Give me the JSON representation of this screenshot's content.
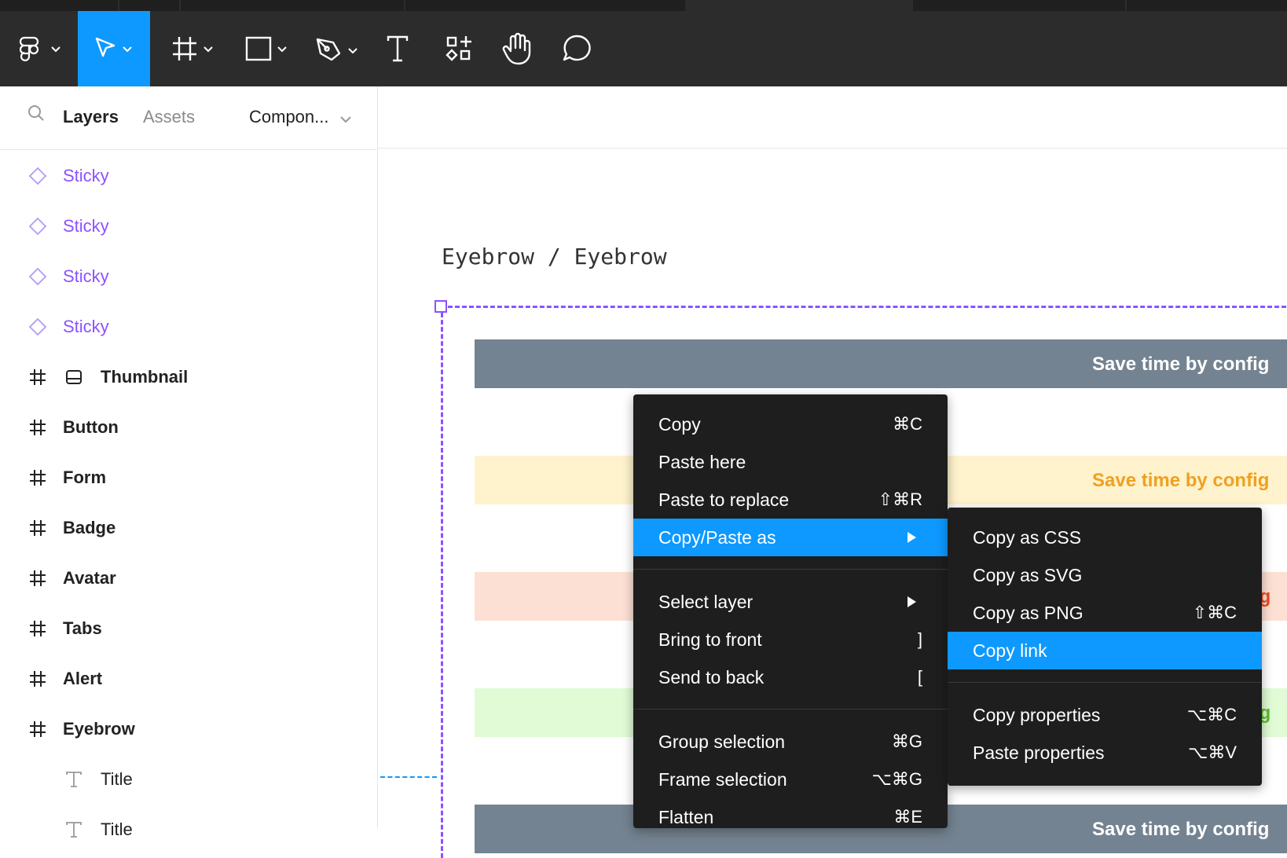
{
  "toolbar": {
    "icons": [
      "figma-menu-icon",
      "move-tool-icon",
      "frame-tool-icon",
      "shape-tool-icon",
      "pen-tool-icon",
      "text-tool-icon",
      "resources-icon",
      "hand-tool-icon",
      "comment-tool-icon"
    ]
  },
  "sidebar": {
    "tabs": {
      "layers": "Layers",
      "assets": "Assets",
      "page": "Compon..."
    },
    "layers": [
      {
        "label": "Sticky",
        "icon": "component-instance-icon",
        "kind": "component"
      },
      {
        "label": "Sticky",
        "icon": "component-instance-icon",
        "kind": "component"
      },
      {
        "label": "Sticky",
        "icon": "component-instance-icon",
        "kind": "component"
      },
      {
        "label": "Sticky",
        "icon": "component-instance-icon",
        "kind": "component"
      },
      {
        "label": "Thumbnail",
        "icon": "frame-icon",
        "kind": "frame"
      },
      {
        "label": "Button",
        "icon": "frame-icon",
        "kind": "frame"
      },
      {
        "label": "Form",
        "icon": "frame-icon",
        "kind": "frame"
      },
      {
        "label": "Badge",
        "icon": "frame-icon",
        "kind": "frame"
      },
      {
        "label": "Avatar",
        "icon": "frame-icon",
        "kind": "frame"
      },
      {
        "label": "Tabs",
        "icon": "frame-icon",
        "kind": "frame"
      },
      {
        "label": "Alert",
        "icon": "frame-icon",
        "kind": "frame"
      },
      {
        "label": "Eyebrow",
        "icon": "frame-icon",
        "kind": "frame"
      },
      {
        "label": "Title",
        "icon": "text-layer-icon",
        "kind": "text"
      },
      {
        "label": "Title",
        "icon": "text-layer-icon",
        "kind": "text"
      }
    ]
  },
  "canvas": {
    "frame_title": "Eyebrow / Eyebrow",
    "banners": [
      {
        "text": "Save time by config",
        "bg": "#748391",
        "color": "#ffffff"
      },
      {
        "text": "Save time by config",
        "bg": "#fff3cd",
        "color": "#f0a020"
      },
      {
        "text": "fig",
        "bg": "#fde0d4",
        "color": "#f24822"
      },
      {
        "text": "fig",
        "bg": "#e1fbd6",
        "color": "#5bbd2e"
      },
      {
        "text": "Save time by config",
        "bg": "#748391",
        "color": "#ffffff"
      }
    ]
  },
  "context_menu": {
    "items": [
      {
        "label": "Copy",
        "shortcut": "⌘C"
      },
      {
        "label": "Paste here",
        "shortcut": ""
      },
      {
        "label": "Paste to replace",
        "shortcut": "⇧⌘R"
      },
      {
        "label": "Copy/Paste as",
        "shortcut": "",
        "submenu": true,
        "highlighted": true
      },
      {
        "label": "Select layer",
        "shortcut": "",
        "submenu": true
      },
      {
        "label": "Bring to front",
        "shortcut": "]"
      },
      {
        "label": "Send to back",
        "shortcut": "["
      },
      {
        "label": "Group selection",
        "shortcut": "⌘G"
      },
      {
        "label": "Frame selection",
        "shortcut": "⌥⌘G"
      },
      {
        "label": "Flatten",
        "shortcut": "⌘E"
      }
    ]
  },
  "submenu": {
    "items": [
      {
        "label": "Copy as CSS",
        "shortcut": ""
      },
      {
        "label": "Copy as SVG",
        "shortcut": ""
      },
      {
        "label": "Copy as PNG",
        "shortcut": "⇧⌘C"
      },
      {
        "label": "Copy link",
        "shortcut": "",
        "highlighted": true
      },
      {
        "label": "Copy properties",
        "shortcut": "⌥⌘C"
      },
      {
        "label": "Paste properties",
        "shortcut": "⌥⌘V"
      }
    ]
  },
  "colors": {
    "accent": "#0d99ff",
    "selection": "#8c52ff",
    "component": "#8c52ff",
    "toolbar_bg": "#2c2c2c",
    "menu_bg": "#1e1e1e"
  }
}
